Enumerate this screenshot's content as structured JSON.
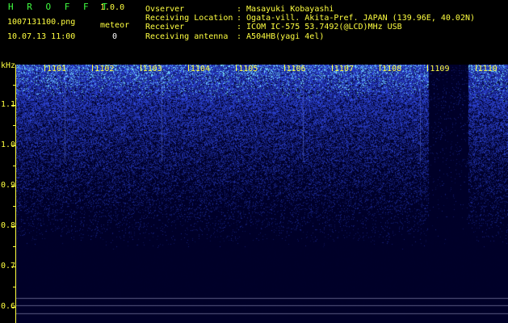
{
  "header": {
    "app_name": "H R O F F T",
    "version": "1.0.0",
    "filename": "1007131100.png",
    "datetime": "10.07.13 11:00",
    "meteor_label": "meteor",
    "meteor_count": "0",
    "info": [
      {
        "label": "Ovserver",
        "value": ": Masayuki Kobayashi"
      },
      {
        "label": "Receiving Location",
        "value": ": Ogata-vill. Akita-Pref. JAPAN (139.96E, 40.02N)"
      },
      {
        "label": "Receiver",
        "value": ": ICOM IC-575 53.7492(@LCD)MHz USB"
      },
      {
        "label": "Receiving antenna",
        "value": ": A504HB(yagi 4el)"
      }
    ]
  },
  "axis": {
    "unit": "kHz",
    "ticks": [
      {
        "label": "1.1",
        "value": 1.1
      },
      {
        "label": "1.0",
        "value": 1.0
      },
      {
        "label": "0.9",
        "value": 0.9
      },
      {
        "label": "0.8",
        "value": 0.8
      },
      {
        "label": "0.7",
        "value": 0.7
      },
      {
        "label": "0.6",
        "value": 0.6
      }
    ]
  },
  "minutes": [
    "1101",
    "1102",
    "1103",
    "1104",
    "1105",
    "1106",
    "1107",
    "1108",
    "1109",
    "1110"
  ],
  "colors": {
    "label": "#ffff40",
    "title": "#40ff40",
    "noise_bright": "#3050ff"
  }
}
